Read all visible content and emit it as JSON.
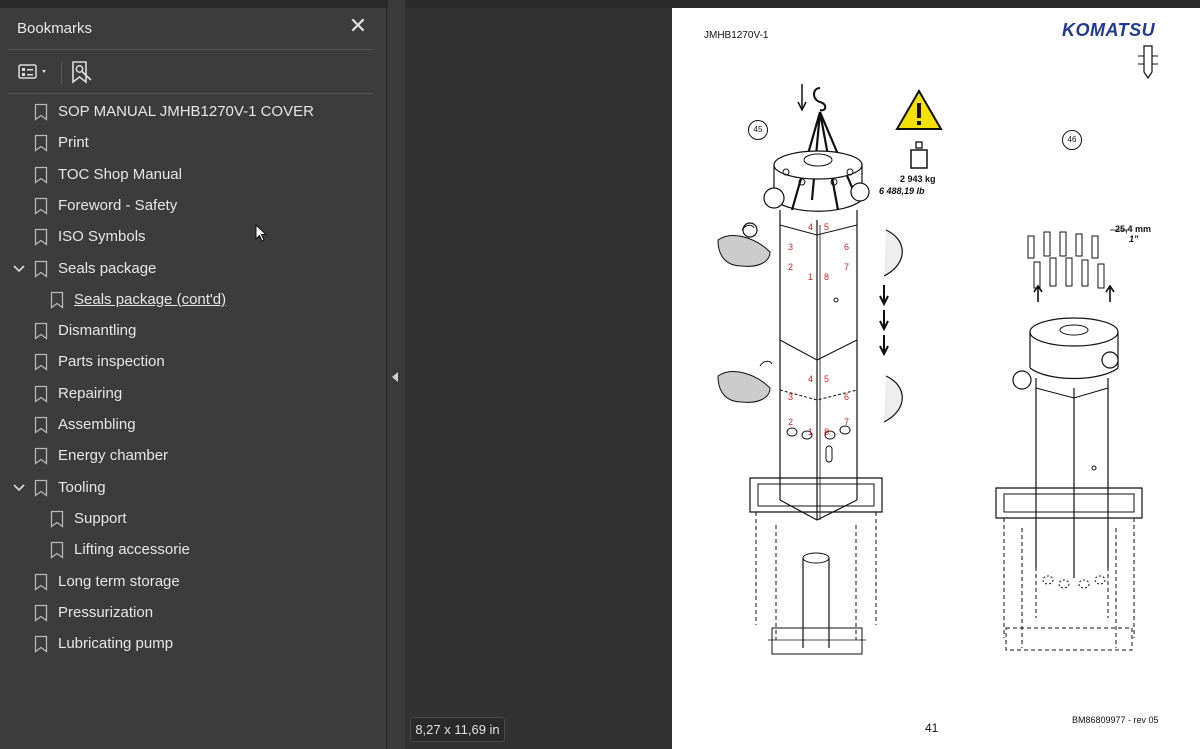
{
  "sidebar": {
    "title": "Bookmarks",
    "close_icon": "close-icon",
    "toolbar": {
      "options_icon": "options-menu-icon",
      "add_bookmark_icon": "add-bookmark-icon"
    },
    "items": [
      {
        "label": "SOP MANUAL JMHB1270V-1 COVER",
        "level": 0,
        "expandable": false
      },
      {
        "label": "Print",
        "level": 0,
        "expandable": false
      },
      {
        "label": "TOC Shop Manual",
        "level": 0,
        "expandable": false
      },
      {
        "label": "Foreword - Safety",
        "level": 0,
        "expandable": false
      },
      {
        "label": "ISO Symbols",
        "level": 0,
        "expandable": false
      },
      {
        "label": "Seals package",
        "level": 0,
        "expandable": true,
        "expanded": true
      },
      {
        "label": "Seals package (cont'd)",
        "level": 1,
        "expandable": false,
        "active": true
      },
      {
        "label": "Dismantling",
        "level": 0,
        "expandable": false
      },
      {
        "label": "Parts inspection",
        "level": 0,
        "expandable": false
      },
      {
        "label": "Repairing",
        "level": 0,
        "expandable": false
      },
      {
        "label": "Assembling",
        "level": 0,
        "expandable": false
      },
      {
        "label": "Energy chamber",
        "level": 0,
        "expandable": false
      },
      {
        "label": "Tooling",
        "level": 0,
        "expandable": true,
        "expanded": true
      },
      {
        "label": "Support",
        "level": 1,
        "expandable": false
      },
      {
        "label": "Lifting accessorie",
        "level": 1,
        "expandable": false
      },
      {
        "label": "Long term storage",
        "level": 0,
        "expandable": false
      },
      {
        "label": "Pressurization",
        "level": 0,
        "expandable": false
      },
      {
        "label": "Lubricating pump",
        "level": 0,
        "expandable": false
      }
    ]
  },
  "page": {
    "header_code": "JMHB1270V-1",
    "logo": "KOMATSU",
    "step_a": "45",
    "step_b": "46",
    "weight_kg": "2 943 kg",
    "weight_lb": "6 488,19 lb",
    "dim_mm": "25,4 mm",
    "dim_in": "1\"",
    "page_number": "41",
    "doc_ref": "BM86809977 - rev 05",
    "size_label": "8,27 x 11,69 in",
    "red_numbers_upper": [
      "3",
      "4",
      "5",
      "6",
      "2",
      "7",
      "1",
      "8"
    ],
    "red_numbers_lower": [
      "4",
      "5",
      "3",
      "6",
      "2",
      "7",
      "1",
      "8"
    ]
  }
}
